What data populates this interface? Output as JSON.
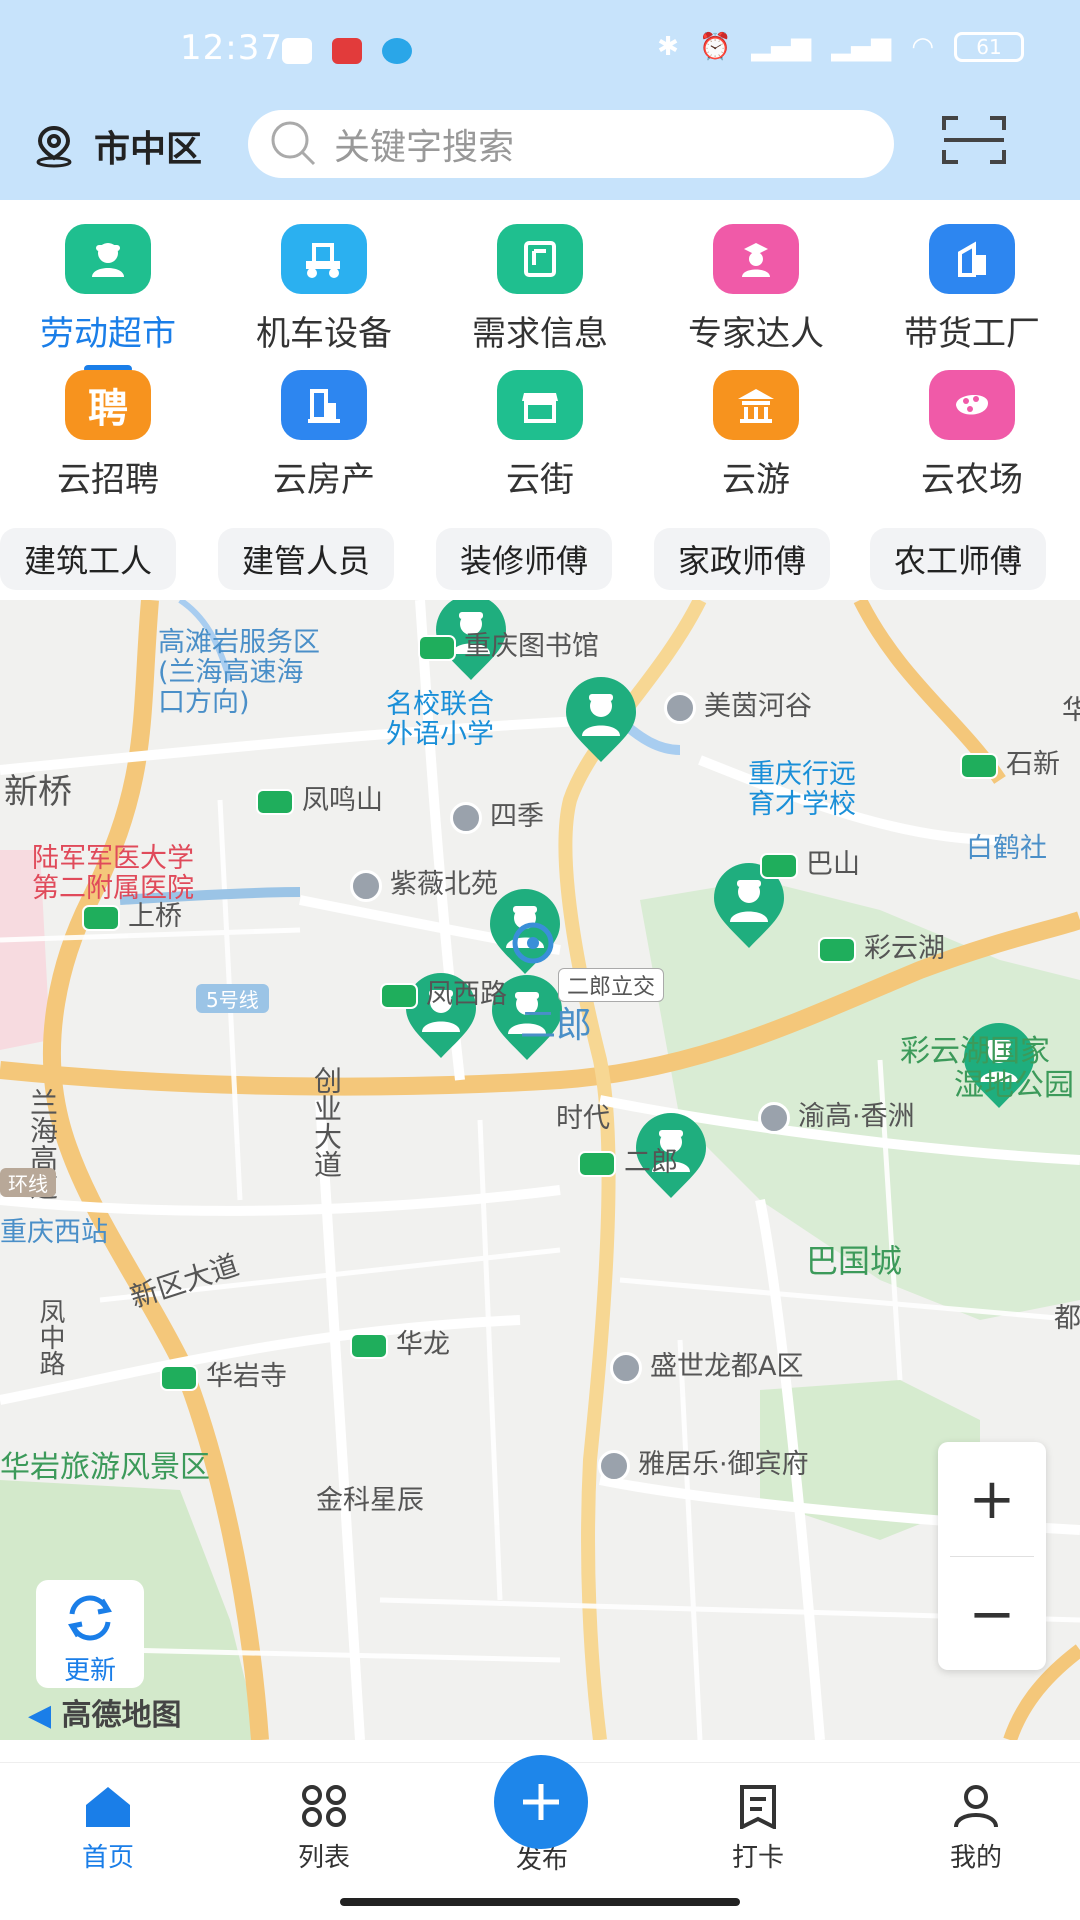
{
  "status": {
    "time": "12:37",
    "battery": "61"
  },
  "header": {
    "location": "市中区",
    "search_placeholder": "关键字搜索"
  },
  "grid": [
    {
      "label": "劳动超市",
      "icon": "worker-icon",
      "color": "#1fbf8f",
      "active": true
    },
    {
      "label": "机车设备",
      "icon": "forklift-icon",
      "color": "#2bb0f0"
    },
    {
      "label": "需求信息",
      "icon": "notice-icon",
      "color": "#1fbf8f"
    },
    {
      "label": "专家达人",
      "icon": "expert-icon",
      "color": "#f05aa8"
    },
    {
      "label": "带货工厂",
      "icon": "factory-icon",
      "color": "#2d86f0"
    },
    {
      "label": "云招聘",
      "icon": "recruit-icon",
      "color": "#f7931e"
    },
    {
      "label": "云房产",
      "icon": "building-icon",
      "color": "#2d86f0"
    },
    {
      "label": "云街",
      "icon": "shop-icon",
      "color": "#1fbf8f"
    },
    {
      "label": "云游",
      "icon": "temple-icon",
      "color": "#f7931e"
    },
    {
      "label": "云农场",
      "icon": "farm-icon",
      "color": "#f05aa8"
    }
  ],
  "recruit_glyph": "聘",
  "chips": [
    "建筑工人",
    "建管人员",
    "装修师傅",
    "家政师傅",
    "农工师傅"
  ],
  "map": {
    "labels": {
      "gaotan": "高滩岩服务区",
      "gaotan2": "(兰海高速海",
      "gaotan3": "口方向)",
      "library": "重庆图书馆",
      "mingxiao": "名校联合",
      "mingxiao2": "外语小学",
      "meiyin": "美茵河谷",
      "xinqiao": "新桥",
      "fengming": "凤鸣山",
      "siji": "四季",
      "chongqingxy": "重庆行远",
      "chongqingxy2": "育才学校",
      "shixin": "石新",
      "hospital": "陆军军医大学",
      "hospital2": "第二附属医院",
      "bashan": "巴山",
      "baihe": "白鹤社",
      "ziwei": "紫薇北苑",
      "shangqiao": "上桥",
      "caiyun": "彩云湖",
      "line5": "5号线",
      "fengxi": "凤西路",
      "erlangjiao": "二郎立交",
      "lanhai": "兰海高速",
      "erlang_area": "二郎",
      "caiyunpark": "彩云湖国家",
      "caiyunpark2": "湿地公园",
      "chuangye": "创业大道",
      "shidai": "时代",
      "yugao": "渝高·香洲",
      "erlang": "二郎",
      "huanxian": "环线",
      "xizhan": "重庆西站",
      "xinqu": "新区大道",
      "baguo": "巴国城",
      "fengzhong": "凤中路",
      "hualong": "华龙",
      "huayan": "华岩寺",
      "shengshi": "盛世龙都A区",
      "dou": "都",
      "huayanfj": "华岩旅游风景区",
      "yajule": "雅居乐·御宾府",
      "jinke": "金科星辰",
      "hua": "华"
    },
    "refresh": "更新",
    "attribution": "高德地图",
    "zoom_in": "+",
    "zoom_out": "−"
  },
  "nav": [
    {
      "label": "首页",
      "icon": "home-icon",
      "active": true
    },
    {
      "label": "列表",
      "icon": "list-icon"
    },
    {
      "label": "发布",
      "icon": "plus-icon"
    },
    {
      "label": "打卡",
      "icon": "checkin-icon"
    },
    {
      "label": "我的",
      "icon": "user-icon"
    }
  ]
}
